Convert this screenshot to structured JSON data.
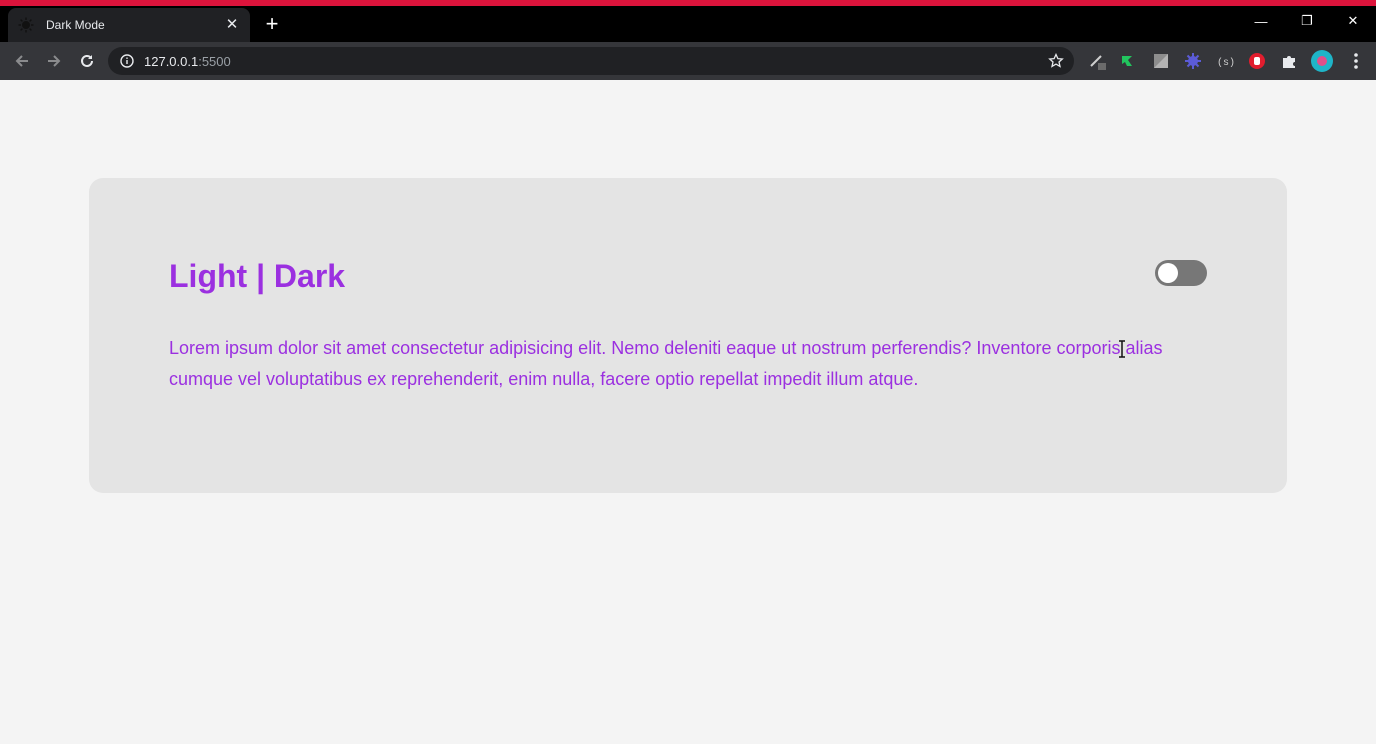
{
  "browser": {
    "tab_title": "Dark Mode",
    "tab_close": "✕",
    "new_tab": "+",
    "url_host": "127.0.0.1",
    "url_port": ":5500",
    "window_controls": {
      "minimize": "—",
      "restore": "❐",
      "close": "✕"
    },
    "accent_color": "#dc143c"
  },
  "card": {
    "heading": "Light | Dark",
    "paragraph": "Lorem ipsum dolor sit amet consectetur adipisicing elit. Nemo deleniti eaque ut nostrum perferendis? Inventore corporis alias cumque vel voluptatibus ex reprehenderit, enim nulla, facere optio repellat impedit illum atque.",
    "text_color": "#9b30e0",
    "toggle_state": "off"
  },
  "icons": [
    "back-icon",
    "forward-icon",
    "reload-icon",
    "info-icon",
    "star-icon",
    "extension-icon",
    "puzzle-icon",
    "profile-avatar",
    "menu-icon"
  ]
}
